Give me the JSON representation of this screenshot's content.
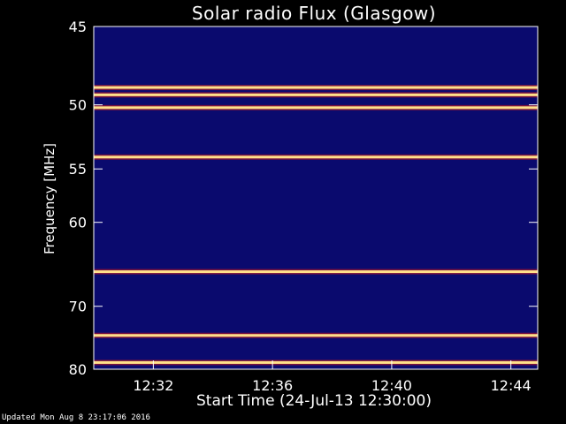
{
  "chart_data": {
    "type": "heatmap",
    "title": "Solar radio Flux (Glasgow)",
    "xlabel": "Start Time (24-Jul-13 12:30:00)",
    "ylabel": "Frequency [MHz]",
    "x_ticks": [
      {
        "label": "12:32",
        "minutes": 2
      },
      {
        "label": "12:36",
        "minutes": 6
      },
      {
        "label": "12:40",
        "minutes": 10
      },
      {
        "label": "12:44",
        "minutes": 14
      }
    ],
    "y_ticks": [
      {
        "label": "45",
        "mhz": 45
      },
      {
        "label": "50",
        "mhz": 50
      },
      {
        "label": "55",
        "mhz": 55
      },
      {
        "label": "60",
        "mhz": 60
      },
      {
        "label": "70",
        "mhz": 70
      },
      {
        "label": "80",
        "mhz": 80
      }
    ],
    "xlim_minutes": [
      0,
      14.9
    ],
    "ylim_mhz": [
      45,
      80
    ],
    "bright_bands_mhz": [
      48.8,
      49.3,
      50.2,
      54.0,
      65.5,
      74.3,
      78.8
    ],
    "colors": {
      "background": "#0a0a6e",
      "band": "#ffe08a",
      "hot": "#d21a1a",
      "frame": "#ffffff"
    }
  },
  "footer": "Updated Mon Aug  8 23:17:06 2016"
}
